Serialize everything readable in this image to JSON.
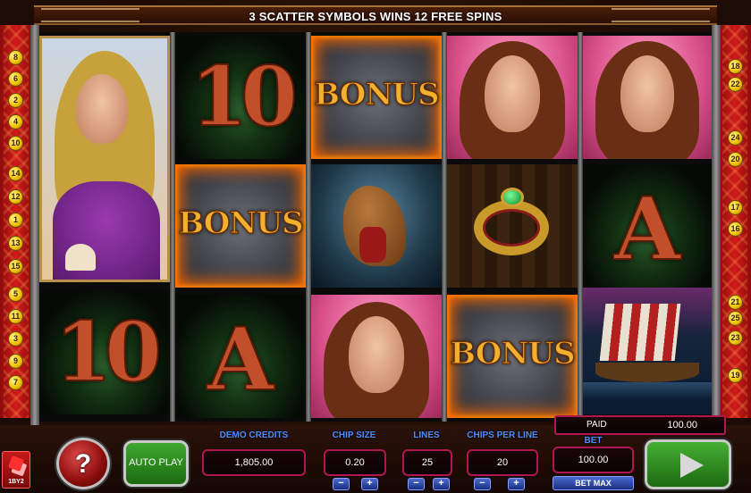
{
  "banner": {
    "text": "3 SCATTER SYMBOLS WINS 12 FREE SPINS"
  },
  "paylines": {
    "left": [
      "8",
      "6",
      "2",
      "4",
      "10",
      "14",
      "12",
      "1",
      "13",
      "15",
      "5",
      "11",
      "3",
      "9",
      "7"
    ],
    "right": [
      "18",
      "22",
      "24",
      "20",
      "17",
      "16",
      "21",
      "25",
      "23",
      "19"
    ]
  },
  "reels": [
    [
      "Blonde Lady",
      "Blonde Lady",
      "10"
    ],
    [
      "10",
      "BONUS",
      "A"
    ],
    [
      "BONUS",
      "Horse",
      "Brunette Lady"
    ],
    [
      "Brunette Lady",
      "Ring",
      "BONUS"
    ],
    [
      "Brunette Lady",
      "A",
      "Viking Ship"
    ]
  ],
  "controls": {
    "logo_text": "1BY2",
    "help_label": "?",
    "autoplay_label": "AUTO PLAY",
    "credits": {
      "label": "DEMO CREDITS",
      "value": "1,805.00"
    },
    "chip_size": {
      "label": "CHIP SIZE",
      "value": "0.20"
    },
    "lines": {
      "label": "LINES",
      "value": "25"
    },
    "chips_per_line": {
      "label": "CHIPS PER LINE",
      "value": "20"
    },
    "paid": {
      "label": "PAID",
      "value": "100.00"
    },
    "bet": {
      "label": "BET",
      "value": "100.00"
    },
    "bet_max_label": "BET MAX",
    "minus": "−",
    "plus": "+"
  },
  "colors": {
    "label_blue": "#4f8cff",
    "box_border": "#b01650",
    "rail_red": "#d21a1a",
    "badge_gold": "#f3c300"
  },
  "icons": {
    "spin": "play-triangle-icon",
    "help": "question-mark-icon"
  }
}
